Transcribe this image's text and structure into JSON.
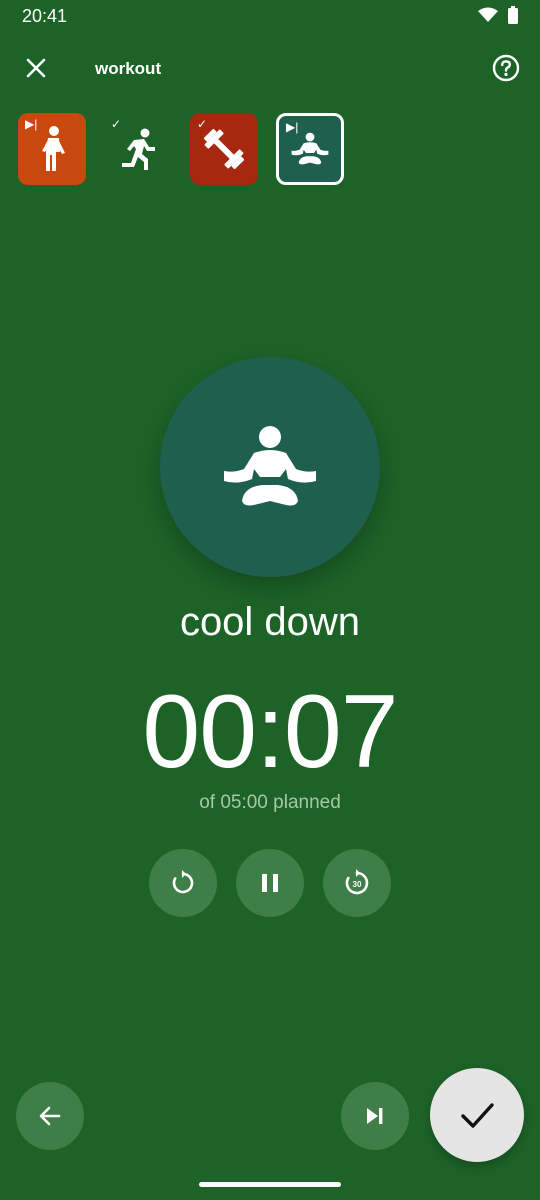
{
  "status_bar": {
    "time": "20:41",
    "icons": [
      "wifi-icon",
      "battery-icon"
    ]
  },
  "app_bar": {
    "title": "workout",
    "close_icon": "close-icon",
    "help_icon": "help-icon"
  },
  "steps": [
    {
      "name": "walk",
      "icon": "walk-icon",
      "marker": "skip",
      "marker_text": "▶|",
      "color": "#c9480e"
    },
    {
      "name": "run",
      "icon": "run-icon",
      "marker": "done",
      "marker_text": "✓",
      "color": "transparent"
    },
    {
      "name": "strength",
      "icon": "dumbbell-icon",
      "marker": "done",
      "marker_text": "✓",
      "color": "#a6280f"
    },
    {
      "name": "cool down",
      "icon": "meditation-icon",
      "marker": "skip",
      "marker_text": "▶|",
      "color": "#1f5f4e",
      "selected": true
    }
  ],
  "current": {
    "activity": "cool down",
    "icon": "meditation-icon",
    "timer": "00:07",
    "planned": "of 05:00 planned"
  },
  "controls": {
    "restart_icon": "restart-icon",
    "pause_icon": "pause-icon",
    "replay30_icon": "replay-30-icon",
    "replay30_label": "30"
  },
  "bottom": {
    "back_icon": "arrow-back-icon",
    "skip_icon": "skip-next-icon",
    "done_icon": "check-icon"
  },
  "colors": {
    "background": "#1d6328",
    "accent": "#1f5f4e",
    "button": "#3f7f47",
    "done_button": "#e5e5e5"
  }
}
